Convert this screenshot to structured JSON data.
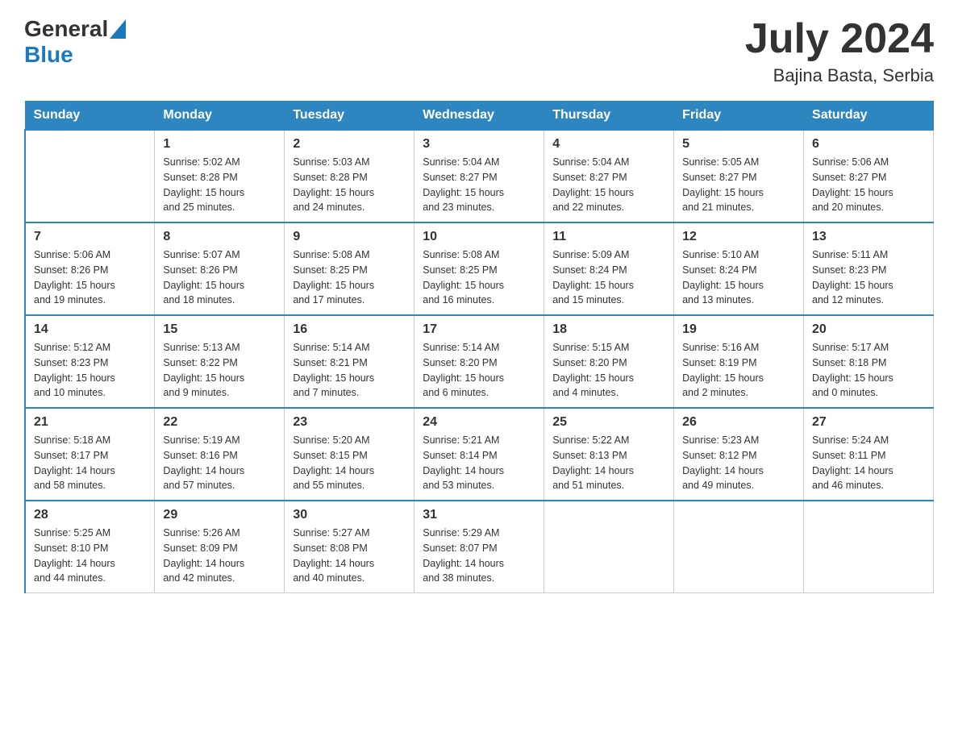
{
  "header": {
    "logo": {
      "general": "General",
      "blue": "Blue"
    },
    "title": "July 2024",
    "subtitle": "Bajina Basta, Serbia"
  },
  "weekdays": [
    "Sunday",
    "Monday",
    "Tuesday",
    "Wednesday",
    "Thursday",
    "Friday",
    "Saturday"
  ],
  "weeks": [
    [
      {
        "day": "",
        "info": ""
      },
      {
        "day": "1",
        "info": "Sunrise: 5:02 AM\nSunset: 8:28 PM\nDaylight: 15 hours\nand 25 minutes."
      },
      {
        "day": "2",
        "info": "Sunrise: 5:03 AM\nSunset: 8:28 PM\nDaylight: 15 hours\nand 24 minutes."
      },
      {
        "day": "3",
        "info": "Sunrise: 5:04 AM\nSunset: 8:27 PM\nDaylight: 15 hours\nand 23 minutes."
      },
      {
        "day": "4",
        "info": "Sunrise: 5:04 AM\nSunset: 8:27 PM\nDaylight: 15 hours\nand 22 minutes."
      },
      {
        "day": "5",
        "info": "Sunrise: 5:05 AM\nSunset: 8:27 PM\nDaylight: 15 hours\nand 21 minutes."
      },
      {
        "day": "6",
        "info": "Sunrise: 5:06 AM\nSunset: 8:27 PM\nDaylight: 15 hours\nand 20 minutes."
      }
    ],
    [
      {
        "day": "7",
        "info": "Sunrise: 5:06 AM\nSunset: 8:26 PM\nDaylight: 15 hours\nand 19 minutes."
      },
      {
        "day": "8",
        "info": "Sunrise: 5:07 AM\nSunset: 8:26 PM\nDaylight: 15 hours\nand 18 minutes."
      },
      {
        "day": "9",
        "info": "Sunrise: 5:08 AM\nSunset: 8:25 PM\nDaylight: 15 hours\nand 17 minutes."
      },
      {
        "day": "10",
        "info": "Sunrise: 5:08 AM\nSunset: 8:25 PM\nDaylight: 15 hours\nand 16 minutes."
      },
      {
        "day": "11",
        "info": "Sunrise: 5:09 AM\nSunset: 8:24 PM\nDaylight: 15 hours\nand 15 minutes."
      },
      {
        "day": "12",
        "info": "Sunrise: 5:10 AM\nSunset: 8:24 PM\nDaylight: 15 hours\nand 13 minutes."
      },
      {
        "day": "13",
        "info": "Sunrise: 5:11 AM\nSunset: 8:23 PM\nDaylight: 15 hours\nand 12 minutes."
      }
    ],
    [
      {
        "day": "14",
        "info": "Sunrise: 5:12 AM\nSunset: 8:23 PM\nDaylight: 15 hours\nand 10 minutes."
      },
      {
        "day": "15",
        "info": "Sunrise: 5:13 AM\nSunset: 8:22 PM\nDaylight: 15 hours\nand 9 minutes."
      },
      {
        "day": "16",
        "info": "Sunrise: 5:14 AM\nSunset: 8:21 PM\nDaylight: 15 hours\nand 7 minutes."
      },
      {
        "day": "17",
        "info": "Sunrise: 5:14 AM\nSunset: 8:20 PM\nDaylight: 15 hours\nand 6 minutes."
      },
      {
        "day": "18",
        "info": "Sunrise: 5:15 AM\nSunset: 8:20 PM\nDaylight: 15 hours\nand 4 minutes."
      },
      {
        "day": "19",
        "info": "Sunrise: 5:16 AM\nSunset: 8:19 PM\nDaylight: 15 hours\nand 2 minutes."
      },
      {
        "day": "20",
        "info": "Sunrise: 5:17 AM\nSunset: 8:18 PM\nDaylight: 15 hours\nand 0 minutes."
      }
    ],
    [
      {
        "day": "21",
        "info": "Sunrise: 5:18 AM\nSunset: 8:17 PM\nDaylight: 14 hours\nand 58 minutes."
      },
      {
        "day": "22",
        "info": "Sunrise: 5:19 AM\nSunset: 8:16 PM\nDaylight: 14 hours\nand 57 minutes."
      },
      {
        "day": "23",
        "info": "Sunrise: 5:20 AM\nSunset: 8:15 PM\nDaylight: 14 hours\nand 55 minutes."
      },
      {
        "day": "24",
        "info": "Sunrise: 5:21 AM\nSunset: 8:14 PM\nDaylight: 14 hours\nand 53 minutes."
      },
      {
        "day": "25",
        "info": "Sunrise: 5:22 AM\nSunset: 8:13 PM\nDaylight: 14 hours\nand 51 minutes."
      },
      {
        "day": "26",
        "info": "Sunrise: 5:23 AM\nSunset: 8:12 PM\nDaylight: 14 hours\nand 49 minutes."
      },
      {
        "day": "27",
        "info": "Sunrise: 5:24 AM\nSunset: 8:11 PM\nDaylight: 14 hours\nand 46 minutes."
      }
    ],
    [
      {
        "day": "28",
        "info": "Sunrise: 5:25 AM\nSunset: 8:10 PM\nDaylight: 14 hours\nand 44 minutes."
      },
      {
        "day": "29",
        "info": "Sunrise: 5:26 AM\nSunset: 8:09 PM\nDaylight: 14 hours\nand 42 minutes."
      },
      {
        "day": "30",
        "info": "Sunrise: 5:27 AM\nSunset: 8:08 PM\nDaylight: 14 hours\nand 40 minutes."
      },
      {
        "day": "31",
        "info": "Sunrise: 5:29 AM\nSunset: 8:07 PM\nDaylight: 14 hours\nand 38 minutes."
      },
      {
        "day": "",
        "info": ""
      },
      {
        "day": "",
        "info": ""
      },
      {
        "day": "",
        "info": ""
      }
    ]
  ]
}
